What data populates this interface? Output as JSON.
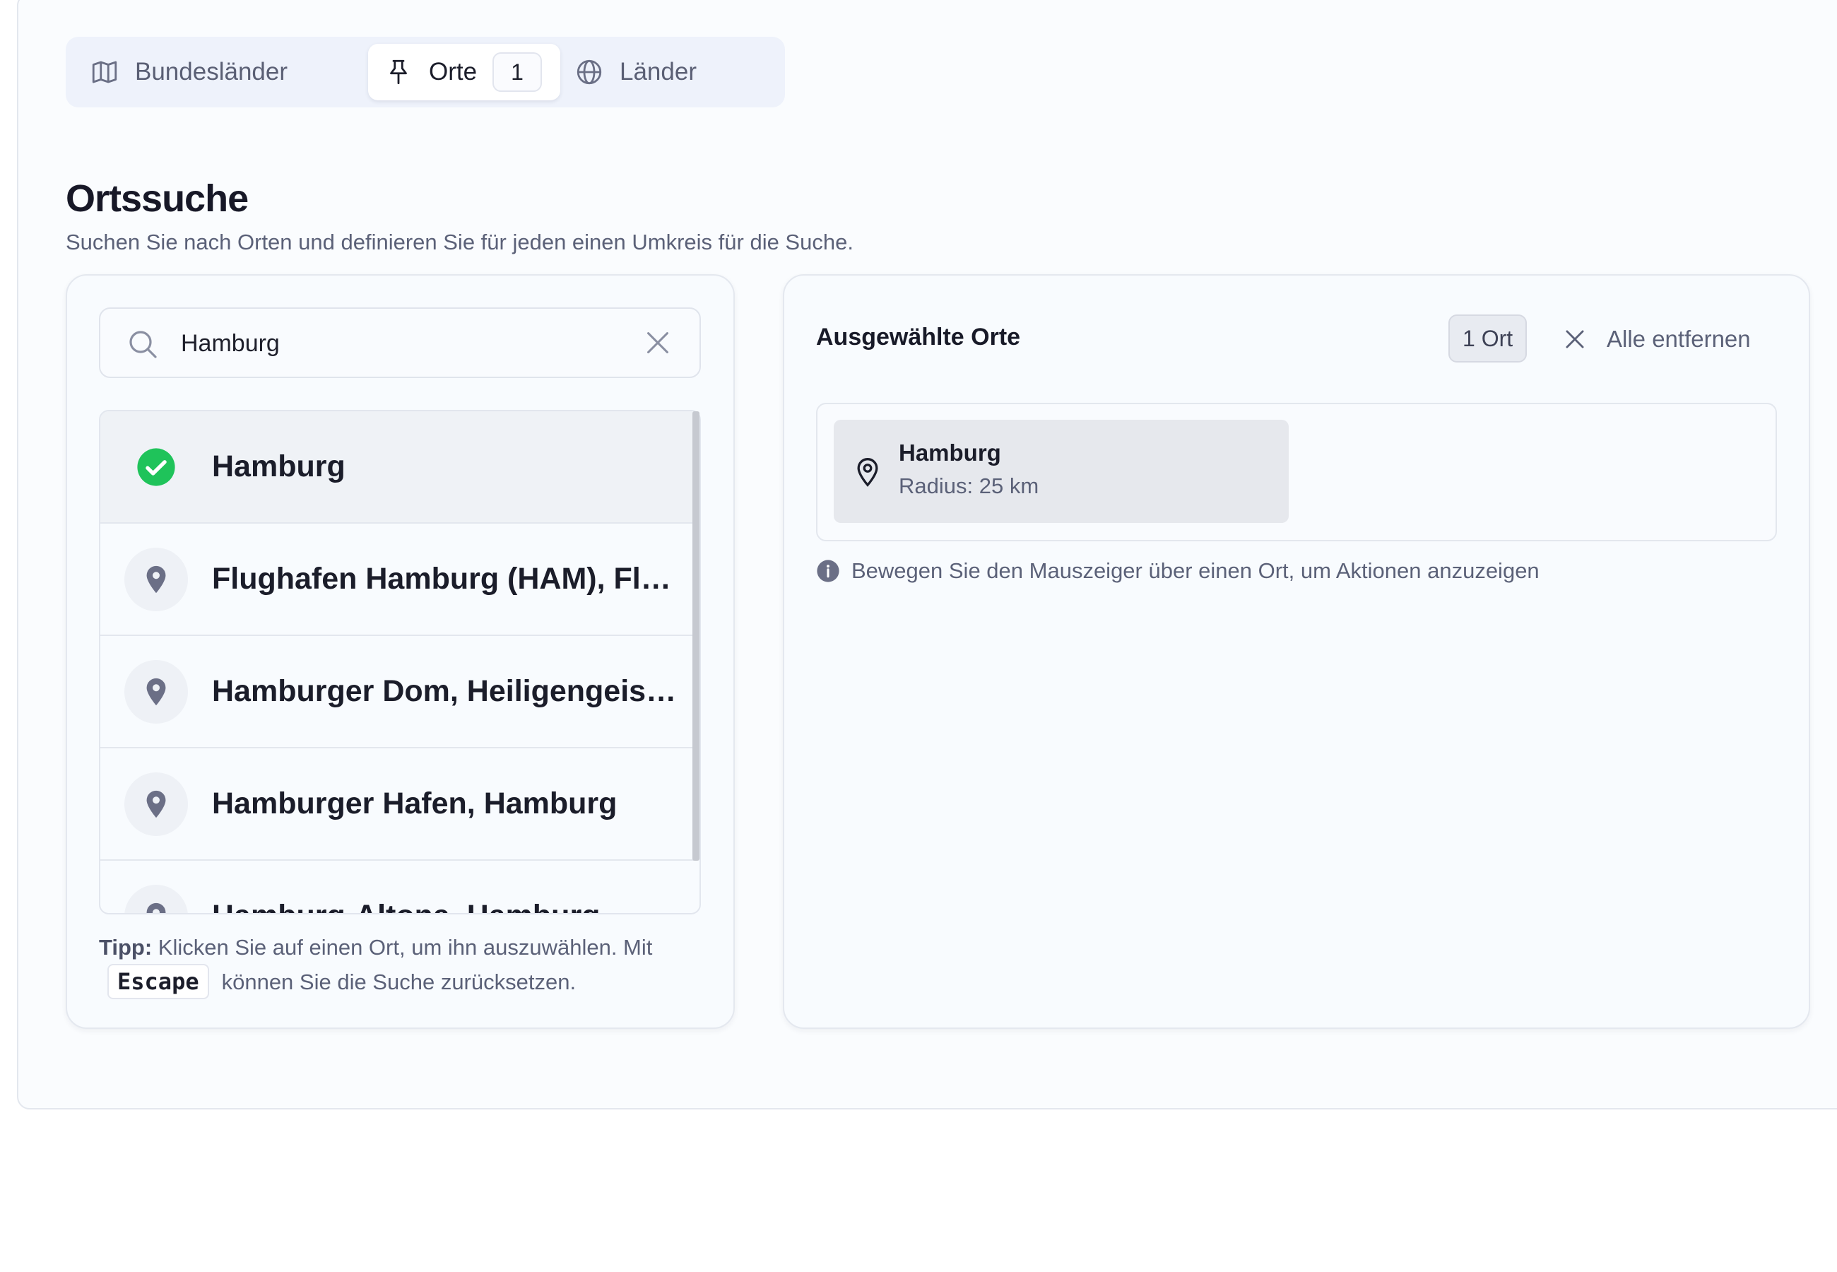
{
  "tabs": [
    {
      "label": "Bundesländer",
      "icon": "map-icon"
    },
    {
      "label": "Orte",
      "icon": "pin-icon",
      "badge": "1",
      "active": true
    },
    {
      "label": "Länder",
      "icon": "globe-icon"
    }
  ],
  "header": {
    "title": "Ortssuche",
    "subtitle": "Suchen Sie nach Orten und definieren Sie für jeden einen Umkreis für die Suche."
  },
  "search": {
    "value": "Hamburg"
  },
  "results": [
    {
      "label": "Hamburg",
      "selected": true,
      "icon": "check-circle-icon"
    },
    {
      "label": "Flughafen Hamburg (HAM), Flughafen",
      "icon": "location-pin-icon"
    },
    {
      "label": "Hamburger Dom, Heiligengeistfeld",
      "icon": "location-pin-icon"
    },
    {
      "label": "Hamburger Hafen, Hamburg",
      "icon": "location-pin-icon"
    },
    {
      "label": "Hamburg-Altona, Hamburg",
      "icon": "location-pin-icon"
    }
  ],
  "tip": {
    "prefix": "Tipp:",
    "text1": " Klicken Sie auf einen Ort, um ihn auszuwählen. Mit",
    "key": "Escape",
    "text2": "können Sie die Suche zurücksetzen."
  },
  "selected_panel": {
    "title": "Ausgewählte Orte",
    "count": "1 Ort",
    "remove_all": "Alle entfernen",
    "items": [
      {
        "name": "Hamburg",
        "radius": "Radius: 25 km"
      }
    ],
    "hint": "Bewegen Sie den Mauszeiger über einen Ort, um Aktionen anzuzeigen"
  },
  "colors": {
    "accent_green": "#1fc35a",
    "pin_gray": "#6b6f86",
    "background": "#fafcfe"
  }
}
